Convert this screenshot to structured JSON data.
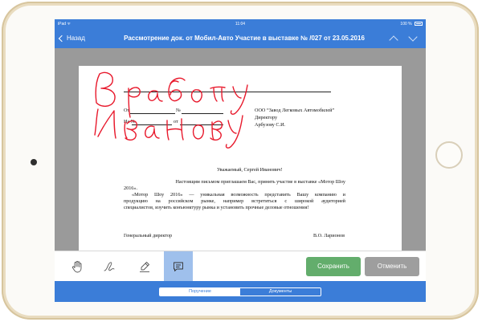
{
  "status_bar": {
    "carrier": "iPad ᯤ",
    "time": "11:04",
    "battery": "100 %"
  },
  "nav": {
    "back_label": "Назад",
    "title": "Рассмотрение док. от Мобил-Авто Участие в выставке № /027 от 23.05.2016"
  },
  "document": {
    "from_label": "От",
    "number_label": "№",
    "in_label": "На №",
    "from_label2": "от",
    "recipient_org": "ООО “Завод Легковых Автомобилей”",
    "recipient_title": "Директору",
    "recipient_name": "Арбузову С.И.",
    "greeting": "Уважаемый, Сергей Иванович!",
    "paragraph1": "Настоящим письмом приглашаем Вас, принять участие в выставке «Мотор Шоу",
    "paragraph1_end": "2016».",
    "paragraph2_l1": "«Мотор Шоу 2016» — уникальная возможность представить Вашу компанию и",
    "paragraph2_l2": "продукцию на российском рынке, например встретиться с широкой аудиторией",
    "paragraph2_l3": "специалистов, изучить конъюнктуру рынка и установить прочные деловые отношения!",
    "signer_title": "Генеральный директор",
    "signer_name": "В.О. Ларионов",
    "handwriting": "В работу Иванову"
  },
  "toolbar": {
    "tools": [
      "hand-icon",
      "pen-scribble-icon",
      "highlighter-icon",
      "comment-icon"
    ],
    "active_tool": "comment-icon",
    "save_label": "Сохранить",
    "cancel_label": "Отменить"
  },
  "tabs": {
    "items": [
      "Поручение",
      "Документы"
    ],
    "selected": "Поручение"
  },
  "colors": {
    "accent": "#3b7dd8",
    "save": "#63ad6c",
    "cancel": "#9e9e9e",
    "ink": "#e8192c",
    "device_frame": "#e9dcc0"
  }
}
